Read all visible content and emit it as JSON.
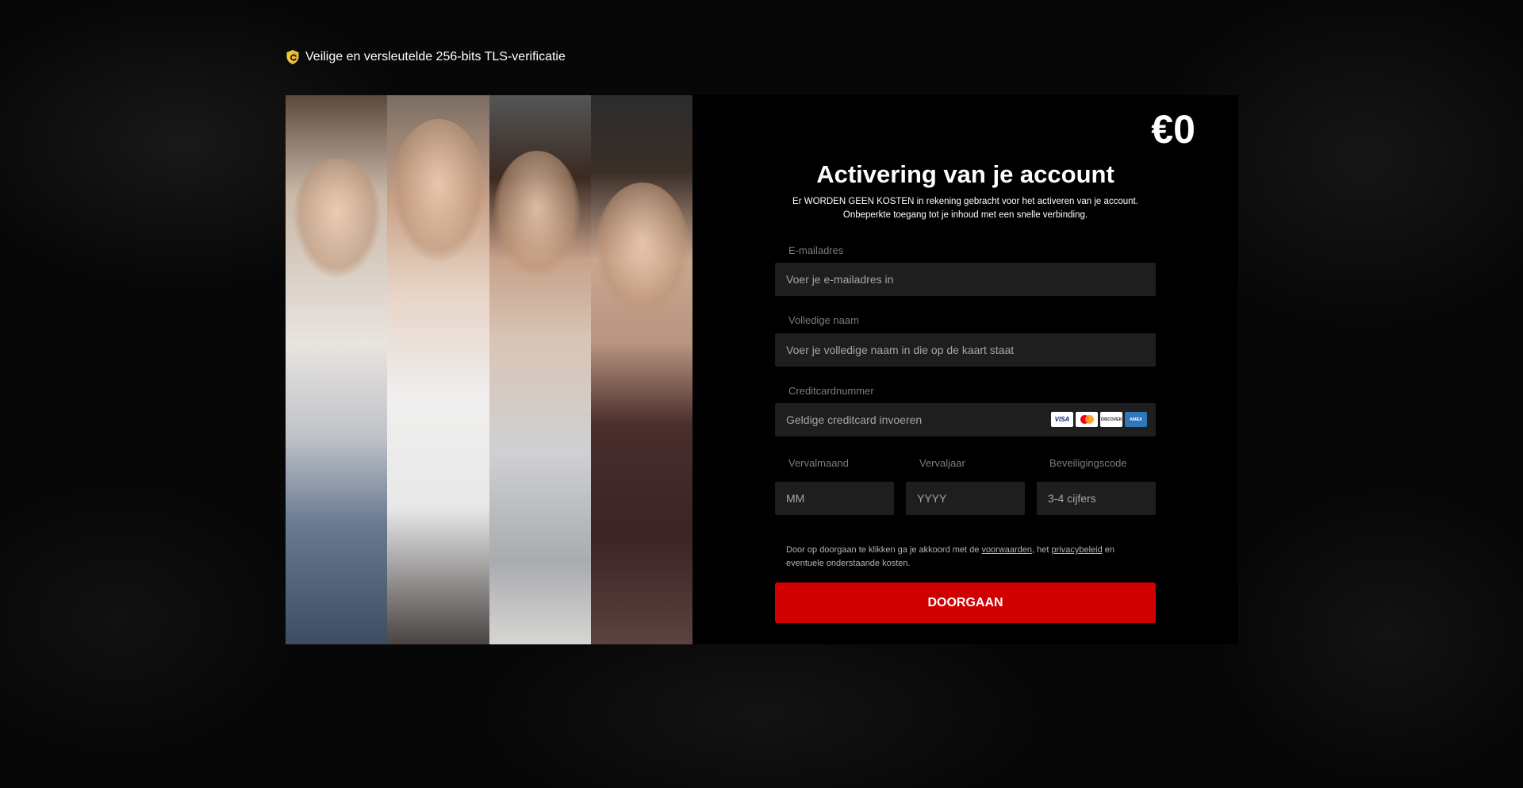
{
  "security": {
    "icon": "shield-check-icon",
    "text": "Veilige en versleutelde 256-bits TLS-verificatie"
  },
  "price": "€0",
  "form": {
    "title": "Activering van je account",
    "subtitle_line1": "Er WORDEN GEEN KOSTEN in rekening gebracht voor het activeren van je account.",
    "subtitle_line2": "Onbeperkte toegang tot je inhoud met een snelle verbinding.",
    "email": {
      "label": "E-mailadres",
      "placeholder": "Voer je e-mailadres in"
    },
    "name": {
      "label": "Volledige naam",
      "placeholder": "Voer je volledige naam in die op de kaart staat"
    },
    "card_number": {
      "label": "Creditcardnummer",
      "placeholder": "Geldige creditcard invoeren",
      "logos": [
        "VISA",
        "mastercard",
        "DISCOVER",
        "AMEX"
      ]
    },
    "exp_month": {
      "label": "Vervalmaand",
      "placeholder": "MM"
    },
    "exp_year": {
      "label": "Vervaljaar",
      "placeholder": "YYYY"
    },
    "cvc": {
      "label": "Beveiligingscode",
      "placeholder": "3-4 cijfers"
    },
    "terms": {
      "part1": "Door op doorgaan te klikken ga je akkoord met de ",
      "link_terms": "voorwaarden",
      "part2": ", het ",
      "link_privacy": "privacybeleid",
      "part3": " en eventuele onderstaande kosten."
    },
    "submit_label": "DOORGAAN"
  },
  "colors": {
    "accent": "#d10000",
    "background": "#000000",
    "field_bg": "#1e1e1e",
    "label": "#7c7c7c"
  }
}
